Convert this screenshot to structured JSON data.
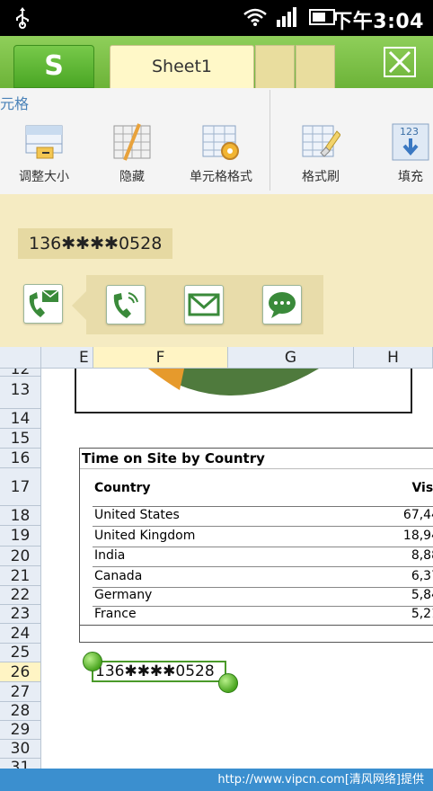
{
  "status_bar": {
    "time": "下午3:04"
  },
  "tabs": {
    "logo": "S",
    "sheet_name": "Sheet1"
  },
  "toolbar": {
    "group_label": "元格",
    "tools": [
      "调整大小",
      "隐藏",
      "单元格格式",
      "格式刷",
      "填充"
    ]
  },
  "panel": {
    "phone_number": "136✱✱✱✱0528"
  },
  "grid": {
    "columns": [
      "E",
      "F",
      "G",
      "H"
    ],
    "rows": [
      "12",
      "13",
      "14",
      "15",
      "16",
      "17",
      "18",
      "19",
      "20",
      "21",
      "22",
      "23",
      "24",
      "25",
      "26",
      "27",
      "28",
      "29",
      "30",
      "31"
    ],
    "selected_row": "26"
  },
  "table": {
    "title": "Time on Site by Country",
    "headers": {
      "country": "Country",
      "visits": "Visi"
    },
    "rows": [
      {
        "country": "United States",
        "visits": "67,44"
      },
      {
        "country": "United Kingdom",
        "visits": "18,94"
      },
      {
        "country": "India",
        "visits": "8,88"
      },
      {
        "country": "Canada",
        "visits": "6,37"
      },
      {
        "country": "Germany",
        "visits": "5,84"
      },
      {
        "country": "France",
        "visits": "5,21"
      }
    ]
  },
  "cell_edit": {
    "value": "136✱✱✱✱0528"
  },
  "footer": {
    "watermark": "http://www.vipcn.com[清风网络]提供"
  },
  "colors": {
    "accent_green": "#6cb338",
    "sheet_tab": "#fff8c8",
    "panel_bg": "#f5ebc2",
    "footer_blue": "#3b8fcf"
  }
}
